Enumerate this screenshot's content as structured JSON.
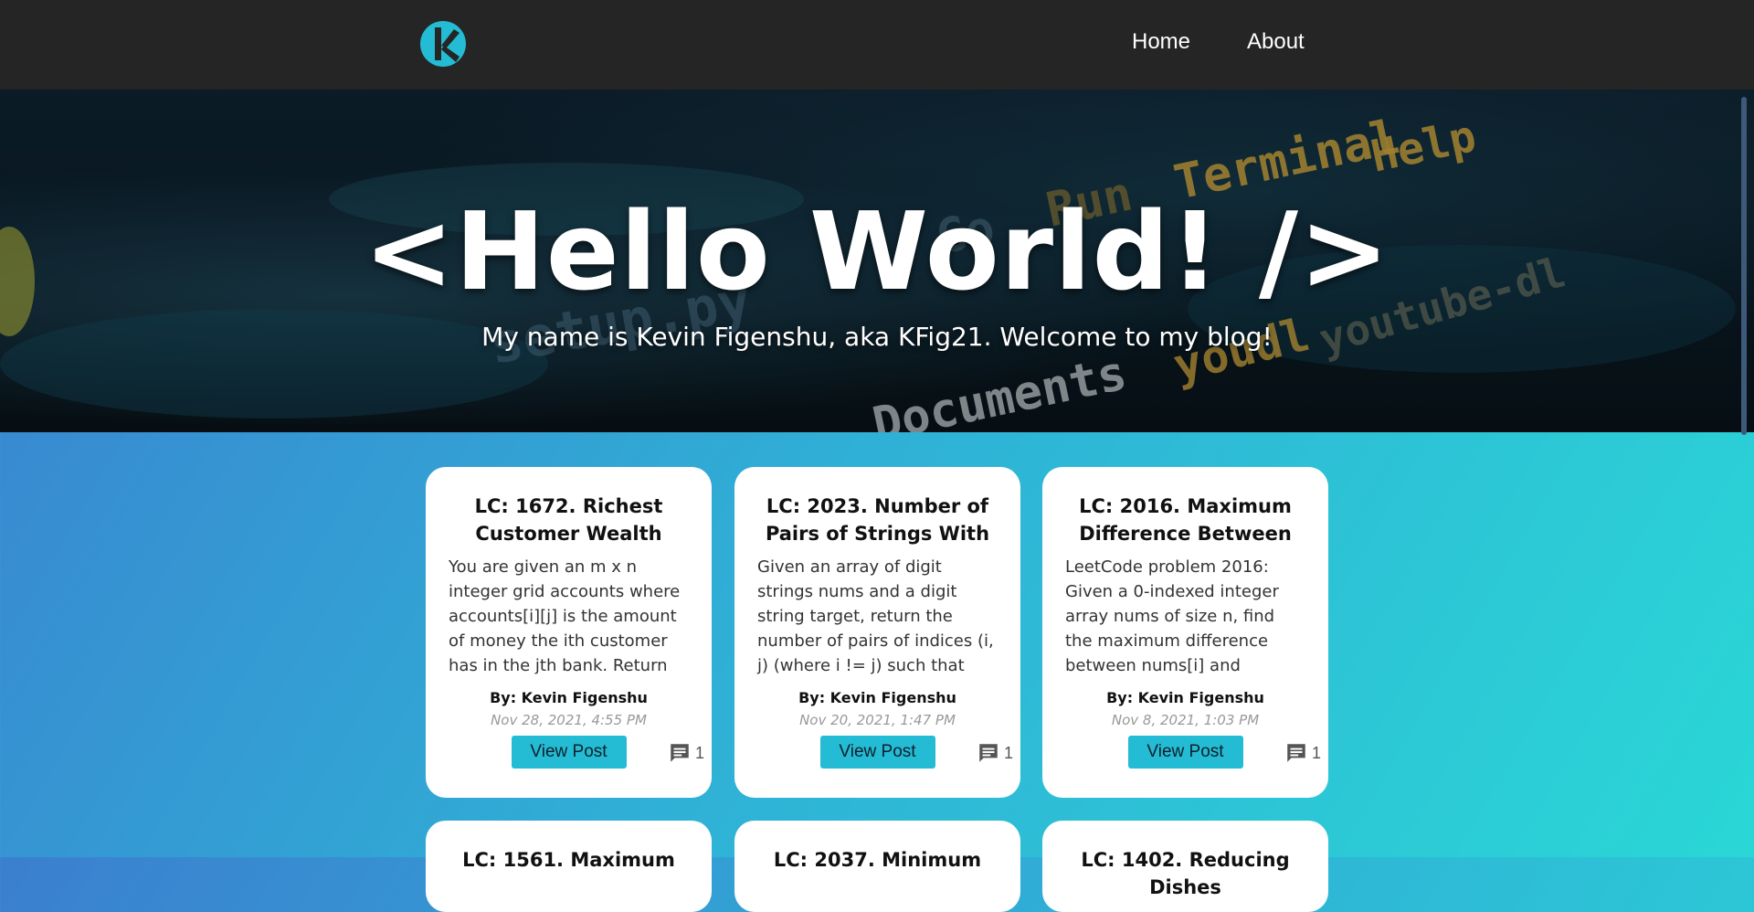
{
  "nav": {
    "logo_alt": "K logo",
    "links": [
      {
        "label": "Home"
      },
      {
        "label": "About"
      }
    ]
  },
  "hero": {
    "title": "<Hello World! />",
    "subtitle": "My name is Kevin Figenshu, aka KFig21. Welcome to my blog!",
    "background_terms": [
      "Terminal",
      "Help",
      "Run",
      "Go",
      "setup.py",
      "Documents",
      "youdl",
      "youtube-dl"
    ]
  },
  "posts": [
    {
      "title": "LC: 1672. Richest Customer Wealth",
      "description": "You are given an m x n integer grid accounts where accounts[i][j] is the amount of money the ith customer has in the jth bank. Return the…",
      "author": "By: Kevin Figenshu",
      "date": "Nov 28, 2021, 4:55 PM",
      "button": "View Post",
      "comments": "1"
    },
    {
      "title": "LC: 2023. Number of Pairs of Strings With",
      "description": "Given an array of digit strings nums and a digit string target, return the number of pairs of indices (i, j) (where i != j) such that the…",
      "author": "By: Kevin Figenshu",
      "date": "Nov 20, 2021, 1:47 PM",
      "button": "View Post",
      "comments": "1"
    },
    {
      "title": "LC: 2016. Maximum Difference Between",
      "description": "LeetCode problem 2016: Given a 0-indexed integer array nums of size n, find the maximum difference between nums[i] and nums[j] (i.e.,…",
      "author": "By: Kevin Figenshu",
      "date": "Nov 8, 2021, 1:03 PM",
      "button": "View Post",
      "comments": "1"
    },
    {
      "title": "LC: 1561. Maximum"
    },
    {
      "title": "LC: 2037. Minimum"
    },
    {
      "title": "LC: 1402. Reducing Dishes"
    }
  ],
  "colors": {
    "nav_bg": "#252525",
    "accent": "#23bcd4",
    "gradient_start": "#3b7fcf",
    "gradient_end": "#2ad7d6"
  }
}
